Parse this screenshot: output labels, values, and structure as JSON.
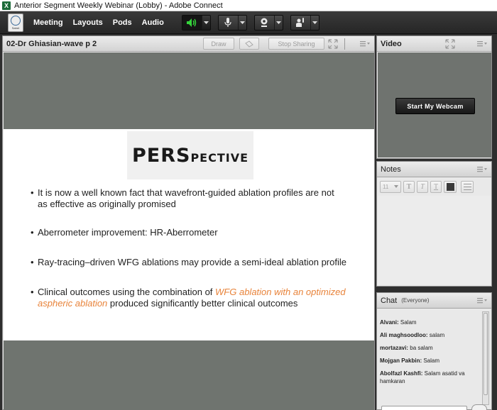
{
  "window": {
    "title": "Anterior Segment Weekly Webinar (Lobby) - Adobe Connect"
  },
  "menubar": {
    "logo_text": "Sabet",
    "items": [
      {
        "label": "Meeting"
      },
      {
        "label": "Layouts"
      },
      {
        "label": "Pods"
      },
      {
        "label": "Audio"
      }
    ],
    "tools": [
      {
        "icon": "speaker-icon",
        "active": true
      },
      {
        "icon": "microphone-icon",
        "active": false
      },
      {
        "icon": "webcam-icon",
        "active": false
      },
      {
        "icon": "raise-hand-icon",
        "active": false
      }
    ]
  },
  "share_pod": {
    "title": "02-Dr Ghiasian-wave p 2",
    "draw_label": "Draw",
    "stop_sharing_label": "Stop Sharing",
    "slide": {
      "title": "PERSPECTIVE",
      "bullets": [
        {
          "text": "It is now a well known fact that wavefront-guided ablation profiles are not as effective as originally promised"
        },
        {
          "text": "Aberrometer improvement: HR-Aberrometer"
        },
        {
          "text": "Ray-tracing–driven WFG ablations may provide a semi-ideal ablation profile"
        },
        {
          "text_before": "Clinical outcomes using the combination of ",
          "highlight": "WFG ablation with an optimized aspheric ablation",
          "text_after": " produced significantly better clinical outcomes"
        }
      ],
      "highlight_color": "#e8833a"
    }
  },
  "video_pod": {
    "title": "Video",
    "start_webcam_label": "Start My Webcam"
  },
  "notes_pod": {
    "title": "Notes",
    "font_size": "11"
  },
  "chat_pod": {
    "title": "Chat",
    "audience": "(Everyone)",
    "messages": [
      {
        "sender": "Alvani:",
        "text": " Salam"
      },
      {
        "sender": "Ali maghsoodloo:",
        "text": " salam"
      },
      {
        "sender": "mortazavi:",
        "text": " ba salam"
      },
      {
        "sender": "Mojgan Pakbin:",
        "text": " Salam"
      },
      {
        "sender": "Abolfazl Kashfi:",
        "text": " Salam asatid va hamkaran"
      }
    ]
  }
}
